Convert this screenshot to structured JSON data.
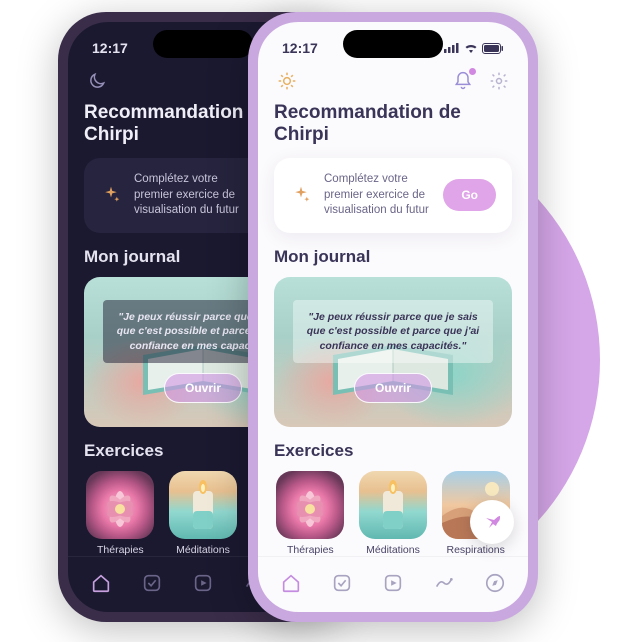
{
  "status": {
    "time": "12:17"
  },
  "header": {
    "title": "Recommandation de Chirpi"
  },
  "recommendation": {
    "text": "Complétez votre premier exercice de visualisation du futur",
    "cta": "Go"
  },
  "journal": {
    "section_title": "Mon journal",
    "quote": "\"Je peux réussir parce que je sais que c'est possible et parce que j'ai confiance en mes capacités.\"",
    "open_label": "Ouvrir"
  },
  "exercises": {
    "section_title": "Exercices",
    "items": [
      {
        "label": "Thérapies"
      },
      {
        "label": "Méditations"
      },
      {
        "label": "Respirations"
      }
    ]
  },
  "colors": {
    "accent": "#c48ce0",
    "accent_light": "#e0a4e8"
  }
}
